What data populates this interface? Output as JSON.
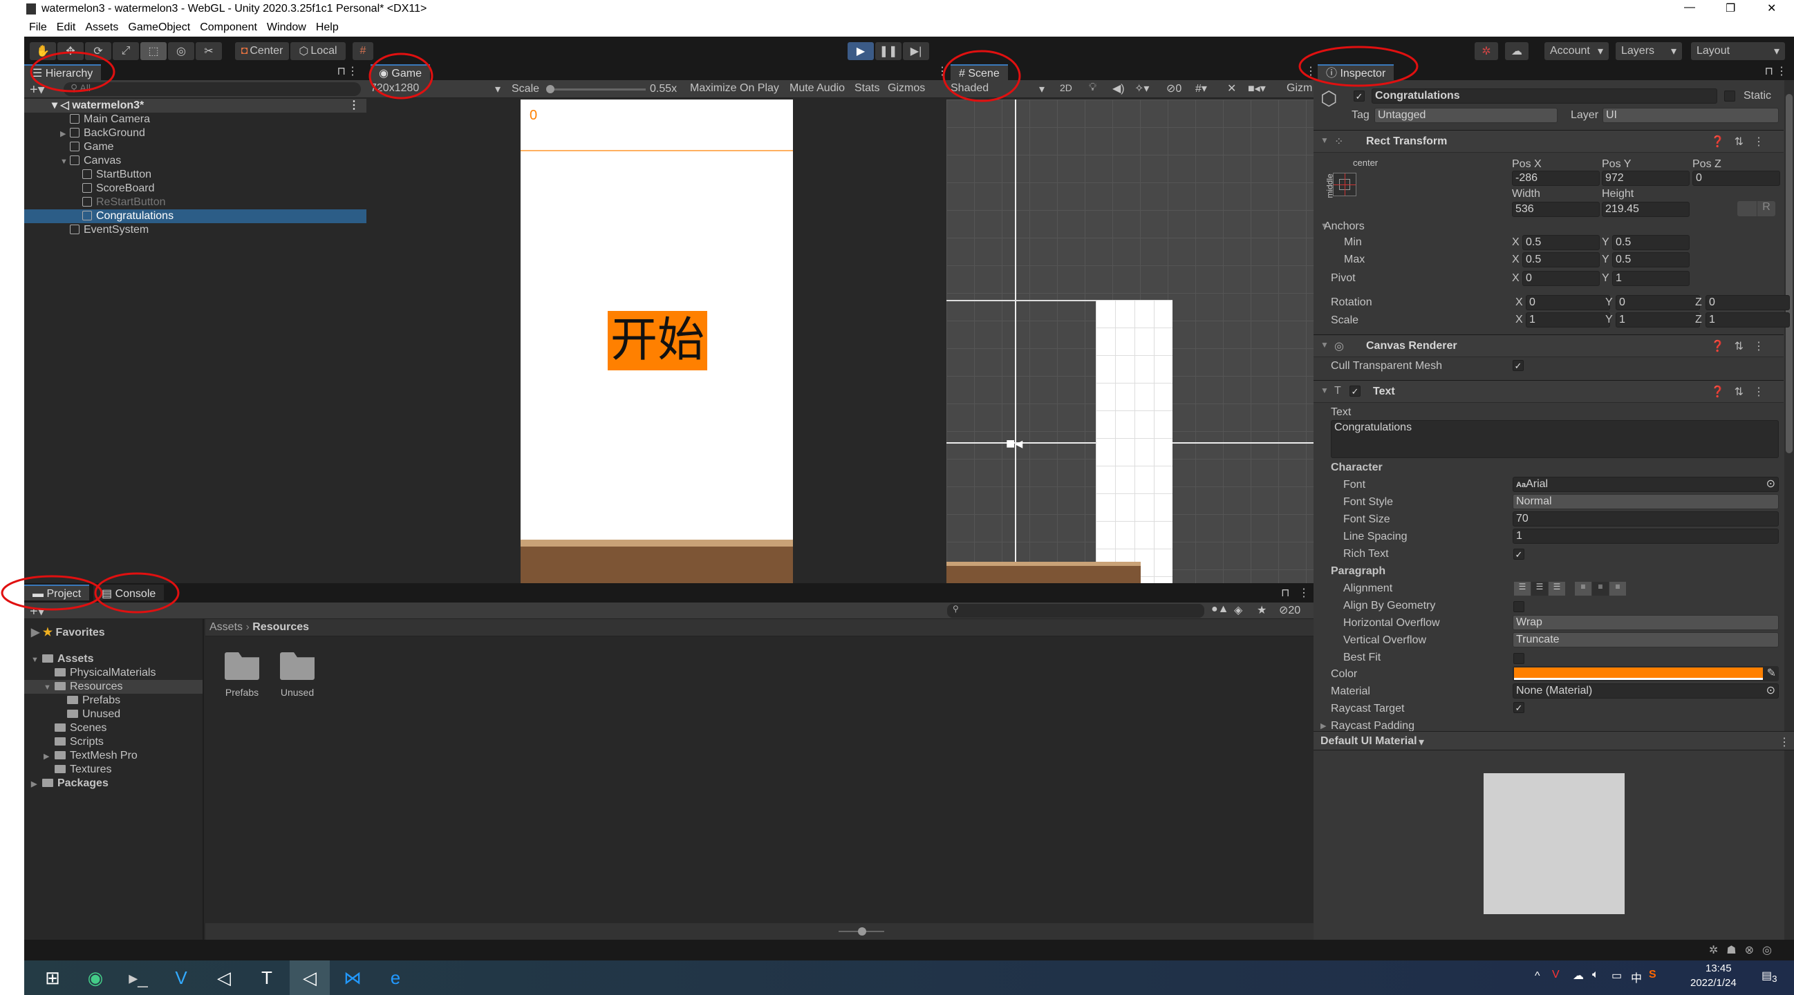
{
  "window": {
    "title": "watermelon3 - watermelon3 - WebGL - Unity 2020.3.25f1c1 Personal* <DX11>",
    "controls": [
      "—",
      "❐",
      "✕"
    ]
  },
  "menu": [
    "File",
    "Edit",
    "Assets",
    "GameObject",
    "Component",
    "Window",
    "Help"
  ],
  "toolbar": {
    "tools": [
      "hand-tool",
      "move-tool",
      "rotate-tool",
      "scale-tool",
      "rect-tool",
      "transform-tool",
      "custom-tool"
    ],
    "pivot": "Center",
    "space": "Local",
    "account": "Account",
    "layers": "Layers",
    "layout": "Layout"
  },
  "hierarchy": {
    "tab": "Hierarchy",
    "search_placeholder": "All",
    "scene": "watermelon3*",
    "items": [
      {
        "label": "Main Camera",
        "depth": 1
      },
      {
        "label": "BackGround",
        "depth": 1,
        "arrow": "▶"
      },
      {
        "label": "Game",
        "depth": 1
      },
      {
        "label": "Canvas",
        "depth": 1,
        "arrow": "▼"
      },
      {
        "label": "StartButton",
        "depth": 2
      },
      {
        "label": "ScoreBoard",
        "depth": 2
      },
      {
        "label": "ReStartButton",
        "depth": 2,
        "inactive": true
      },
      {
        "label": "Congratulations",
        "depth": 2,
        "selected": true
      },
      {
        "label": "EventSystem",
        "depth": 1
      }
    ]
  },
  "game": {
    "tab": "Game",
    "resolution": "720x1280",
    "scale_label": "Scale",
    "scale_value": "0.55x",
    "scale_fraction": 0.0,
    "maximize": "Maximize On Play",
    "mute": "Mute Audio",
    "stats": "Stats",
    "gizmos": "Gizmos",
    "score": "0",
    "start_button": "开始",
    "colors": {
      "score": "#ff8000",
      "button": "#ff8000",
      "ground": "#7d5535",
      "ground_top": "#c9a277"
    }
  },
  "scene": {
    "tab": "Scene",
    "shading": "Shaded",
    "mode_2d": "2D",
    "hidden_count": "0",
    "gizmos": "Gizm"
  },
  "inspector": {
    "tab": "Inspector",
    "object_name": "Congratulations",
    "static": "Static",
    "tag_label": "Tag",
    "tag": "Untagged",
    "layer_label": "Layer",
    "layer": "UI",
    "rect_transform": {
      "title": "Rect Transform",
      "anchor_h": "center",
      "anchor_v": "middle",
      "pos_x_label": "Pos X",
      "pos_y_label": "Pos Y",
      "pos_z_label": "Pos Z",
      "pos_x": "-286",
      "pos_y": "972",
      "pos_z": "0",
      "width_label": "Width",
      "height_label": "Height",
      "width": "536",
      "height": "219.45",
      "raw_edit": "R",
      "anchors": "Anchors",
      "min": "Min",
      "max": "Max",
      "min_x": "0.5",
      "min_y": "0.5",
      "max_x": "0.5",
      "max_y": "0.5",
      "pivot": "Pivot",
      "pivot_x": "0",
      "pivot_y": "1",
      "rotation": "Rotation",
      "rot_x": "0",
      "rot_y": "0",
      "rot_z": "0",
      "scale": "Scale",
      "scale_x": "1",
      "scale_y": "1",
      "scale_z": "1",
      "x": "X",
      "y": "Y",
      "z": "Z"
    },
    "canvas_renderer": {
      "title": "Canvas Renderer",
      "cull_label": "Cull Transparent Mesh",
      "cull": true
    },
    "text": {
      "title": "Text",
      "enabled": true,
      "text_label": "Text",
      "text": "Congratulations",
      "character": "Character",
      "font_label": "Font",
      "font": "Arial",
      "font_style_label": "Font Style",
      "font_style": "Normal",
      "font_size_label": "Font Size",
      "font_size": "70",
      "line_spacing_label": "Line Spacing",
      "line_spacing": "1",
      "rich_text_label": "Rich Text",
      "rich_text": true,
      "paragraph": "Paragraph",
      "alignment_label": "Alignment",
      "align_geom_label": "Align By Geometry",
      "align_geom": false,
      "h_overflow_label": "Horizontal Overflow",
      "h_overflow": "Wrap",
      "v_overflow_label": "Vertical Overflow",
      "v_overflow": "Truncate",
      "best_fit_label": "Best Fit",
      "best_fit": false,
      "color_label": "Color",
      "color": "#ff8000",
      "material_label": "Material",
      "material": "None (Material)",
      "raycast_label": "Raycast Target",
      "raycast": true,
      "raycast_padding": "Raycast Padding"
    },
    "material_section": "Default UI Material"
  },
  "project": {
    "tabs": [
      "Project",
      "Console"
    ],
    "favorites": "Favorites",
    "tree": [
      {
        "label": "Assets",
        "depth": 0,
        "arrow": "▼",
        "bold": true
      },
      {
        "label": "PhysicalMaterials",
        "depth": 1
      },
      {
        "label": "Resources",
        "depth": 1,
        "arrow": "▼",
        "selected": true
      },
      {
        "label": "Prefabs",
        "depth": 2
      },
      {
        "label": "Unused",
        "depth": 2
      },
      {
        "label": "Scenes",
        "depth": 1
      },
      {
        "label": "Scripts",
        "depth": 1
      },
      {
        "label": "TextMesh Pro",
        "depth": 1,
        "arrow": "▶"
      },
      {
        "label": "Textures",
        "depth": 1
      },
      {
        "label": "Packages",
        "depth": 0,
        "arrow": "▶",
        "bold": true
      }
    ],
    "breadcrumb": [
      "Assets",
      "Resources"
    ],
    "folders": [
      "Prefabs",
      "Unused"
    ],
    "hidden_packages": "20"
  },
  "taskbar": {
    "apps": [
      "windows-start",
      "chrome",
      "terminal",
      "v-app",
      "unity-hub",
      "typora",
      "unity",
      "vscode",
      "edge"
    ],
    "time": "13:45",
    "date": "2022/1/24",
    "ime": "中",
    "notifications": "3"
  }
}
